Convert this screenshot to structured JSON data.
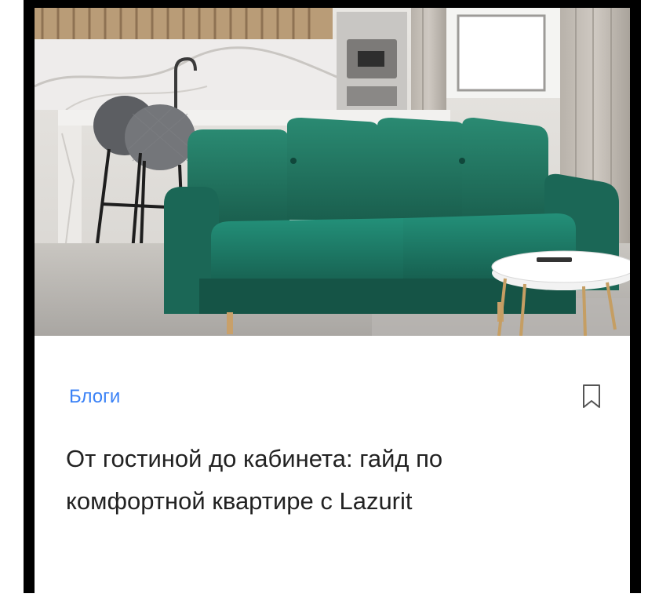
{
  "card": {
    "image_alt": "Зелёный диван в интерьере гостиной с кухней",
    "category": "Блоги",
    "title": "От гостиной до кабинета: гайд по комфортной квартире с Lazurit",
    "bookmark_icon": "bookmark-icon"
  },
  "colors": {
    "category": "#3b82f6",
    "title": "#222222",
    "sofa": "#1f6f5c"
  }
}
